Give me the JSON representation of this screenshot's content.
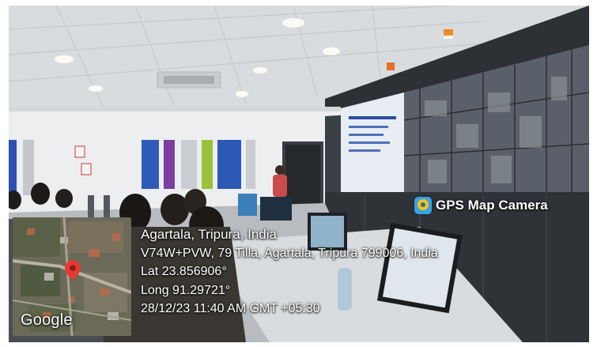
{
  "overlay": {
    "app_name": "GPS Map Camera",
    "app_icon": "gps-map-camera-icon",
    "place": "Agartala, Tripura, India",
    "address": "V74W+PVW, 79 Tilla, Agartala, Tripura 799006, India",
    "latitude": "Lat 23.856906°",
    "longitude": "Long 91.29721°",
    "datetime": "28/12/23 11:40 AM GMT +05:30",
    "map_label": "Google",
    "pin_icon": "location-pin-icon",
    "text_color": "#ffffff",
    "pin_color": "#e53935"
  }
}
